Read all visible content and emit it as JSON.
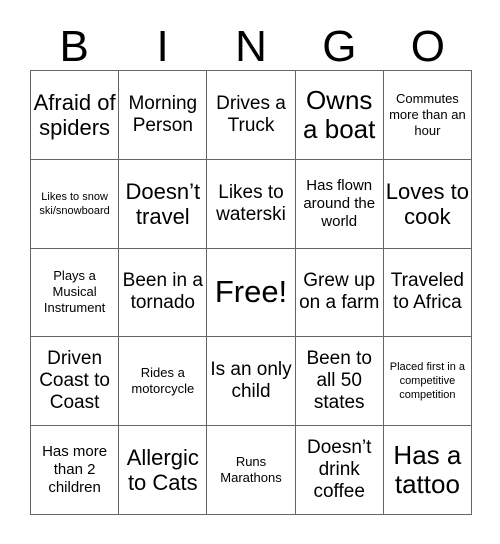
{
  "card": {
    "title": "BINGO",
    "header_letters": [
      "B",
      "I",
      "N",
      "G",
      "O"
    ],
    "grid_size": "5x5",
    "free_space": "Free!",
    "colors": {
      "text": "#000000",
      "border": "#666666",
      "background": "#ffffff"
    }
  },
  "rows": [
    {
      "cells": [
        {
          "text": "Afraid of spiders",
          "size": "lg"
        },
        {
          "text": "Morning Person",
          "size": "md"
        },
        {
          "text": "Drives a Truck",
          "size": "md"
        },
        {
          "text": "Owns a boat",
          "size": "xl"
        },
        {
          "text": "Commutes more than an hour",
          "size": "xs"
        }
      ]
    },
    {
      "cells": [
        {
          "text": "Likes to snow ski/snowboard",
          "size": "xxs"
        },
        {
          "text": "Doesn’t travel",
          "size": "lg"
        },
        {
          "text": "Likes to waterski",
          "size": "md"
        },
        {
          "text": "Has flown around the world",
          "size": "sm"
        },
        {
          "text": "Loves to cook",
          "size": "lg"
        }
      ]
    },
    {
      "cells": [
        {
          "text": "Plays a Musical Instrument",
          "size": "xs"
        },
        {
          "text": "Been in a tornado",
          "size": "md"
        },
        {
          "text": "Free!",
          "size": "xxl"
        },
        {
          "text": "Grew up on a farm",
          "size": "md"
        },
        {
          "text": "Traveled to Africa",
          "size": "md"
        }
      ]
    },
    {
      "cells": [
        {
          "text": "Driven Coast to Coast",
          "size": "md"
        },
        {
          "text": "Rides a motorcycle",
          "size": "xs"
        },
        {
          "text": "Is an only child",
          "size": "md"
        },
        {
          "text": "Been to all 50 states",
          "size": "md"
        },
        {
          "text": "Placed first in a competitive competition",
          "size": "xxs"
        }
      ]
    },
    {
      "cells": [
        {
          "text": "Has more than 2 children",
          "size": "sm"
        },
        {
          "text": "Allergic to Cats",
          "size": "lg"
        },
        {
          "text": "Runs Marathons",
          "size": "xs"
        },
        {
          "text": "Doesn’t drink coffee",
          "size": "md"
        },
        {
          "text": "Has a tattoo",
          "size": "xl"
        }
      ]
    }
  ]
}
